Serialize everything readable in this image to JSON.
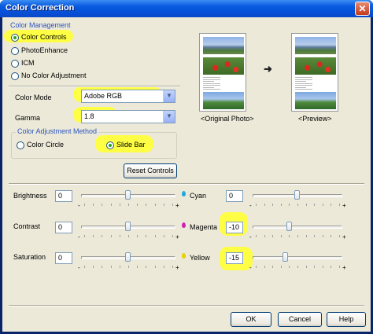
{
  "window": {
    "title": "Color Correction",
    "close_glyph": "✕"
  },
  "color_management": {
    "group_label": "Color Management",
    "options": [
      "Color Controls",
      "PhotoEnhance",
      "ICM",
      "No Color Adjustment"
    ],
    "selected": "Color Controls"
  },
  "preview": {
    "original_label": "<Original Photo>",
    "preview_label": "<Preview>",
    "arrow_glyph": "➜"
  },
  "color_mode": {
    "label": "Color Mode",
    "value": "Adobe RGB"
  },
  "gamma": {
    "label": "Gamma",
    "value": "1.8"
  },
  "adjustment_method": {
    "group_label": "Color Adjustment Method",
    "options": [
      "Color Circle",
      "Slide Bar"
    ],
    "selected": "Slide Bar"
  },
  "reset_button": "Reset Controls",
  "sliders_left": [
    {
      "label": "Brightness",
      "value": "0",
      "level": 0
    },
    {
      "label": "Contrast",
      "value": "0",
      "level": 0
    },
    {
      "label": "Saturation",
      "value": "0",
      "level": 0
    }
  ],
  "sliders_right": [
    {
      "label": "Cyan",
      "value": "0",
      "level": 0,
      "color": "#1fa8e0"
    },
    {
      "label": "Magenta",
      "value": "-10",
      "level": -10,
      "color": "#d21fb4"
    },
    {
      "label": "Yellow",
      "value": "-15",
      "level": -15,
      "color": "#e8cf00"
    }
  ],
  "slider_signs": {
    "minus": "-",
    "plus": "+"
  },
  "buttons": {
    "ok": "OK",
    "cancel": "Cancel",
    "help": "Help"
  },
  "colors": {
    "highlight": "#ffff3c",
    "group_label": "#2b55c0",
    "dialog_bg": "#ece9d8"
  }
}
